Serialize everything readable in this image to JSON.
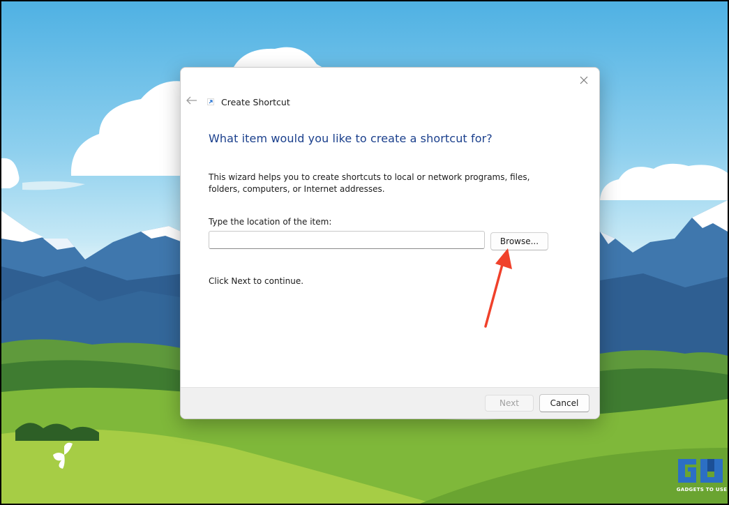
{
  "dialog": {
    "title": "Create Shortcut",
    "heading": "What item would you like to create a shortcut for?",
    "description": "This wizard helps you to create shortcuts to local or network programs, files, folders, computers, or Internet addresses.",
    "location_label": "Type the location of the item:",
    "location_value": "",
    "location_placeholder": "",
    "browse_label": "Browse...",
    "continue_text": "Click Next to continue.",
    "next_label": "Next",
    "cancel_label": "Cancel"
  },
  "icons": {
    "back": "arrow-left-icon",
    "close": "close-icon",
    "shortcut": "shortcut-icon"
  },
  "watermark": {
    "text": "GADGETS TO USE"
  },
  "colors": {
    "heading": "#1a3f8c",
    "annotation_arrow": "#f0412b",
    "sky": "#4fb1e3",
    "meadow": "#7fb83a"
  }
}
